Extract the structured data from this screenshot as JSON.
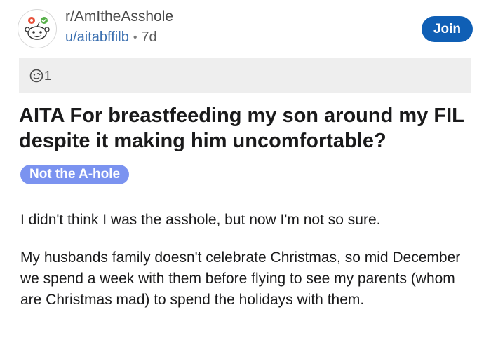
{
  "post": {
    "subreddit": "r/AmItheAsshole",
    "author": "u/aitabffilb",
    "separator": "•",
    "age": "7d",
    "join_label": "Join",
    "award_count": "1",
    "title": "AITA For breastfeeding my son around my FIL despite it making him uncomfortable?",
    "flair": "Not the A-hole",
    "paragraphs": [
      "I didn't think I was the asshole, but now I'm not so sure.",
      "My husbands family doesn't celebrate Christmas, so mid December we spend a week with them before flying to see my parents (whom are Christmas mad) to spend the holidays with them."
    ]
  },
  "colors": {
    "join_button": "#0f5fb5",
    "flair_bg": "#7b93f0",
    "author_link": "#3a6fb0",
    "award_bar_bg": "#eeeeee"
  },
  "icons": {
    "subreddit": "snoo-icon",
    "award": "award-icon"
  }
}
